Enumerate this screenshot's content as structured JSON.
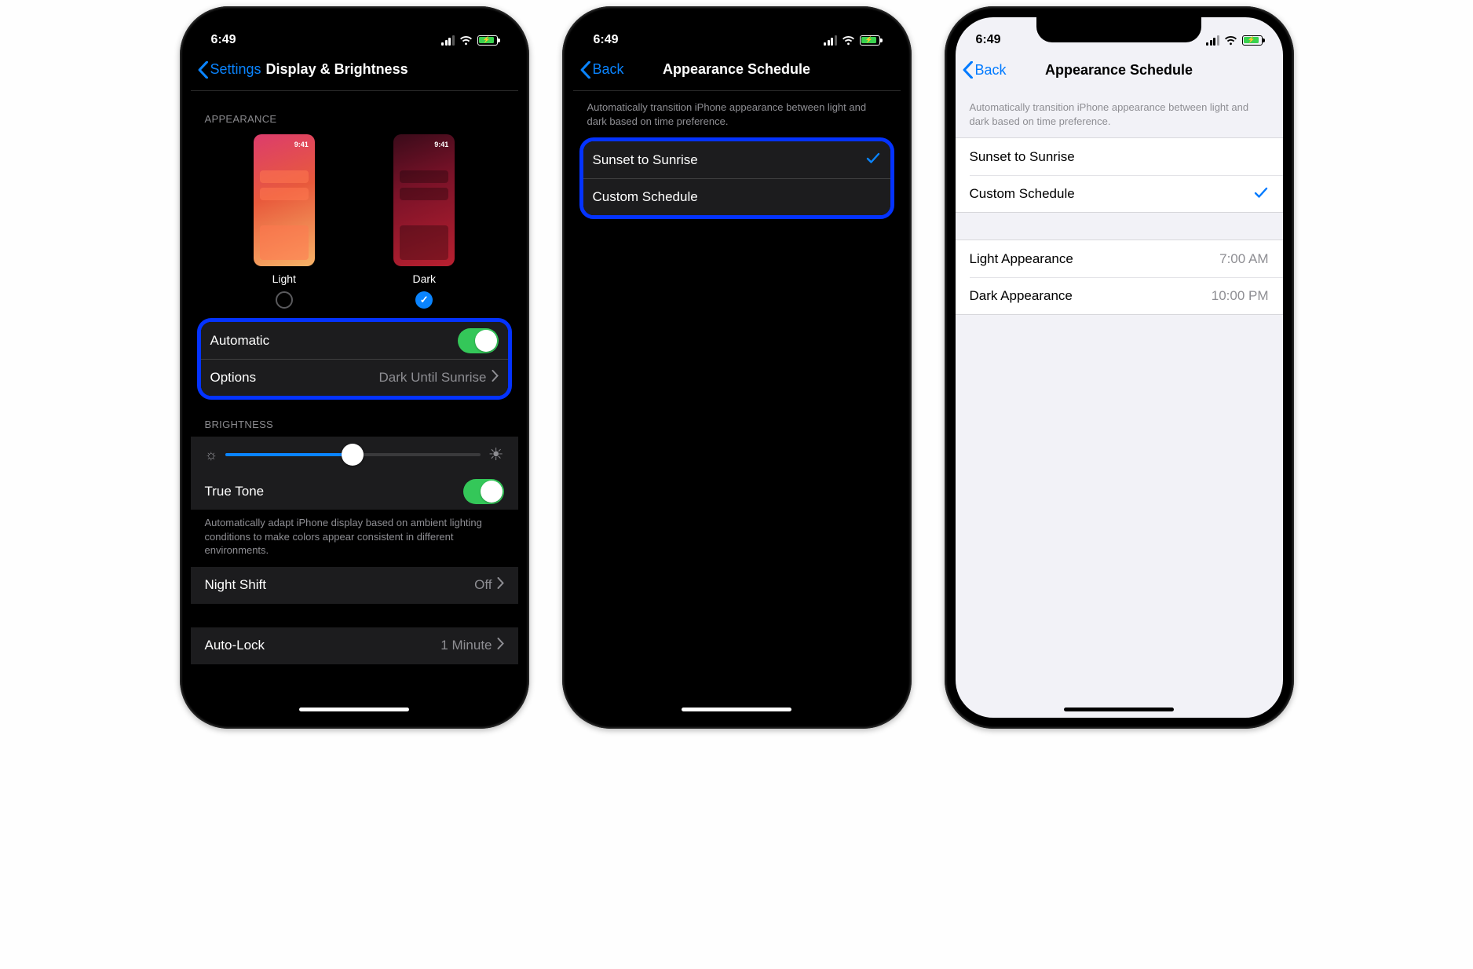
{
  "statusbar": {
    "time": "6:49"
  },
  "phone1": {
    "back": "Settings",
    "title": "Display & Brightness",
    "appearance_header": "APPEARANCE",
    "light_label": "Light",
    "dark_label": "Dark",
    "thumb_time": "9:41",
    "automatic_label": "Automatic",
    "options_label": "Options",
    "options_value": "Dark Until Sunrise",
    "brightness_header": "BRIGHTNESS",
    "truetone_label": "True Tone",
    "truetone_footnote": "Automatically adapt iPhone display based on ambient lighting conditions to make colors appear consistent in different environments.",
    "nightshift_label": "Night Shift",
    "nightshift_value": "Off",
    "autolock_label": "Auto-Lock",
    "autolock_value": "1 Minute"
  },
  "phone2": {
    "back": "Back",
    "title": "Appearance Schedule",
    "footnote": "Automatically transition iPhone appearance between light and dark based on time preference.",
    "opt1": "Sunset to Sunrise",
    "opt2": "Custom Schedule"
  },
  "phone3": {
    "back": "Back",
    "title": "Appearance Schedule",
    "footnote": "Automatically transition iPhone appearance between light and dark based on time preference.",
    "opt1": "Sunset to Sunrise",
    "opt2": "Custom Schedule",
    "light_row": "Light Appearance",
    "light_time": "7:00 AM",
    "dark_row": "Dark Appearance",
    "dark_time": "10:00 PM"
  }
}
